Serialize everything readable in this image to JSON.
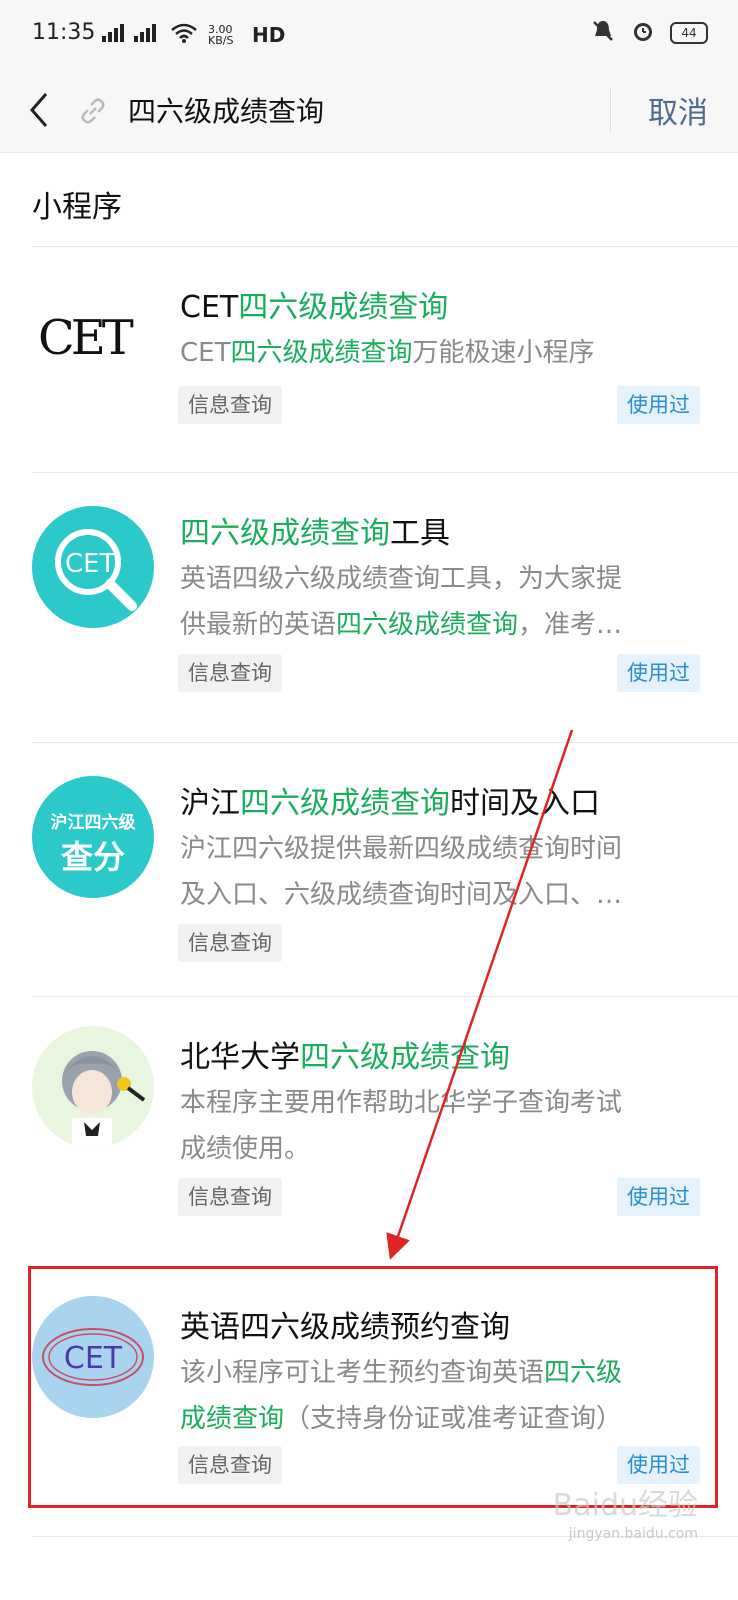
{
  "status_bar": {
    "time": "11:35",
    "network": "2G 4G",
    "speed": "3.00 KB/S",
    "hd": "HD",
    "battery": "44"
  },
  "search": {
    "query": "四六级成绩查询",
    "cancel_label": "取消"
  },
  "section_title": "小程序",
  "results": [
    {
      "title_pre": "CET",
      "title_hl": "四六级成绩查询",
      "title_post": "",
      "desc_line1_pre": "CET",
      "desc_line1_hl": "四六级成绩查询",
      "desc_line1_post": "万能极速小程序",
      "desc_line2_pre": "",
      "desc_line2_hl": "",
      "desc_line2_post": "",
      "tag": "信息查询",
      "used": "使用过",
      "logo_text": "CET"
    },
    {
      "title_pre": "",
      "title_hl": "四六级成绩查询",
      "title_post": "工具",
      "desc_line1_pre": "英语四级六级成绩查询工具，为大家提",
      "desc_line1_hl": "",
      "desc_line1_post": "",
      "desc_line2_pre": "供最新的英语",
      "desc_line2_hl": "四六级成绩查询",
      "desc_line2_post": "，准考…",
      "tag": "信息查询",
      "used": "使用过",
      "logo_text": "CET"
    },
    {
      "title_pre": "沪江",
      "title_hl": "四六级成绩查询",
      "title_post": "时间及入口",
      "desc_line1_pre": "沪江四六级提供最新四级成绩查询时间",
      "desc_line1_hl": "",
      "desc_line1_post": "",
      "desc_line2_pre": "及入口、六级成绩查询时间及入口、…",
      "desc_line2_hl": "",
      "desc_line2_post": "",
      "tag": "信息查询",
      "used": "",
      "logo_text_top": "沪江四六级",
      "logo_text_bottom": "查分"
    },
    {
      "title_pre": "北华大学",
      "title_hl": "四六级成绩查询",
      "title_post": "",
      "desc_line1_pre": "本程序主要用作帮助北华学子查询考试",
      "desc_line1_hl": "",
      "desc_line1_post": "",
      "desc_line2_pre": "成绩使用。",
      "desc_line2_hl": "",
      "desc_line2_post": "",
      "tag": "信息查询",
      "used": "使用过"
    },
    {
      "title_pre": "英语四六级成绩预约查询",
      "title_hl": "",
      "title_post": "",
      "desc_line1_pre": "该小程序可让考生预约查询英语",
      "desc_line1_hl": "四六级",
      "desc_line1_post": "",
      "desc_line2_pre": "",
      "desc_line2_hl": "成绩查询",
      "desc_line2_post": "（支持身份证或准考证查询）",
      "tag": "信息查询",
      "used": "使用过",
      "logo_text": "CET"
    }
  ],
  "watermark": "Baidu经验",
  "watermark_sub": "jingyan.baidu.com",
  "colors": {
    "highlight": "#1aad5a",
    "cancel": "#4e6c8f",
    "annotation": "#e02424"
  }
}
